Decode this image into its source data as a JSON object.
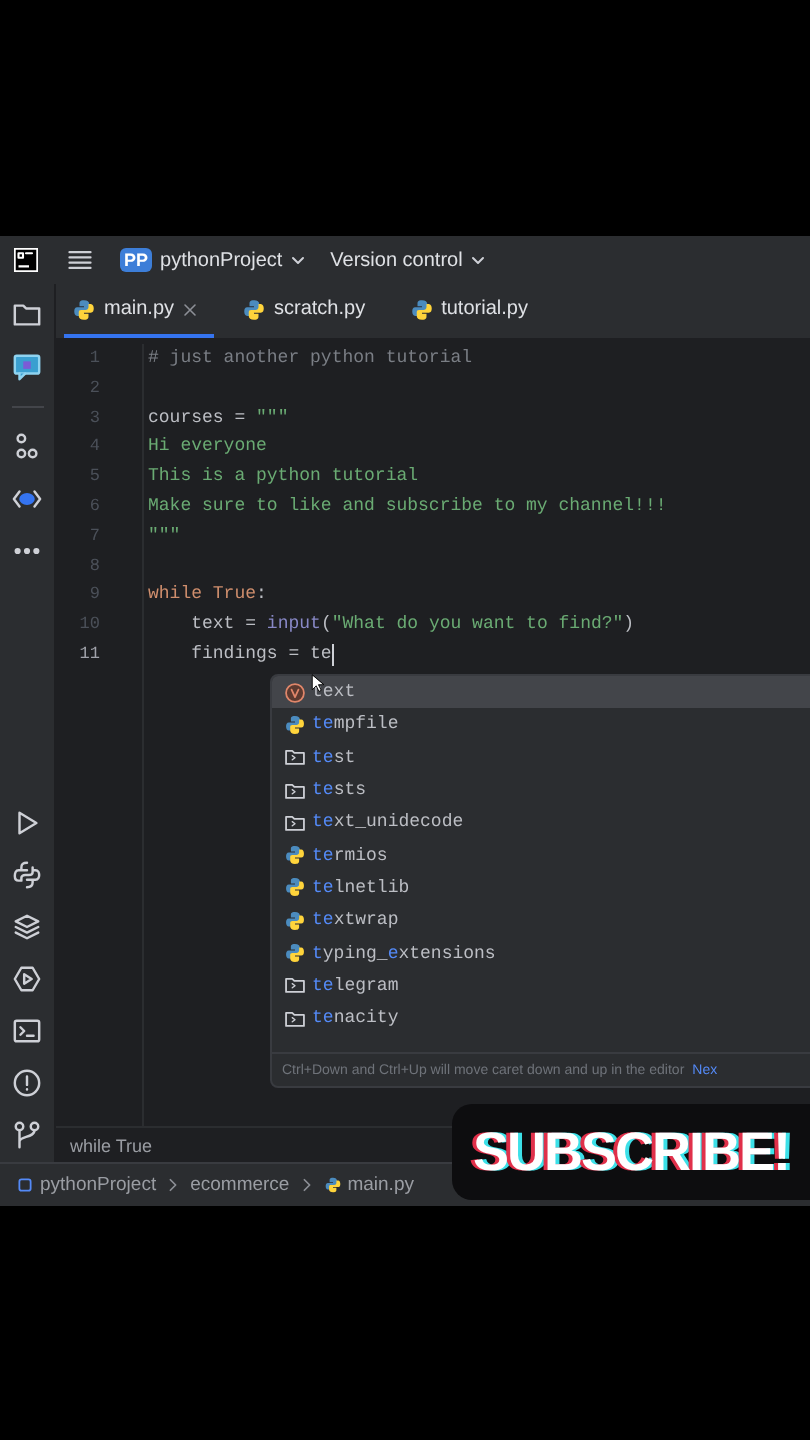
{
  "header": {
    "project_badge": "PP",
    "project": "pythonProject",
    "vcs": "Version control"
  },
  "tabs": [
    {
      "label": "main.py",
      "selected": true,
      "closable": true
    },
    {
      "label": "scratch.py",
      "selected": false,
      "closable": false
    },
    {
      "label": "tutorial.py",
      "selected": false,
      "closable": false
    }
  ],
  "editor": {
    "lines": [
      {
        "number": "1",
        "current": false,
        "segments": [
          {
            "kind": "comment",
            "text": "# just another python tutorial"
          }
        ]
      },
      {
        "number": "2",
        "current": false
      },
      {
        "number": "3",
        "current": false,
        "segments": [
          {
            "kind": "plain",
            "text": "courses = "
          },
          {
            "kind": "string",
            "text": "\"\"\""
          }
        ]
      },
      {
        "number": "4",
        "current": false,
        "segments": [
          {
            "kind": "string",
            "text": "Hi everyone"
          }
        ]
      },
      {
        "number": "5",
        "current": false,
        "segments": [
          {
            "kind": "string",
            "text": "This is a python tutorial"
          }
        ]
      },
      {
        "number": "6",
        "current": false,
        "segments": [
          {
            "kind": "string",
            "text": "Make sure to like and subscribe to my channel!!!"
          }
        ]
      },
      {
        "number": "7",
        "current": false,
        "segments": [
          {
            "kind": "string",
            "text": "\"\"\""
          }
        ]
      },
      {
        "number": "8",
        "current": false
      },
      {
        "number": "9",
        "current": false,
        "segments": [
          {
            "kind": "keyword",
            "text": "while True"
          },
          {
            "kind": "plain",
            "text": ":"
          }
        ]
      },
      {
        "number": "10",
        "current": false,
        "segments": [
          {
            "kind": "plain",
            "text": "    text = "
          },
          {
            "kind": "builtin",
            "text": "input"
          },
          {
            "kind": "plain",
            "text": "("
          },
          {
            "kind": "string",
            "text": "\"What do you want to find?\""
          },
          {
            "kind": "plain",
            "text": ")"
          }
        ]
      },
      {
        "number": "11",
        "current": true,
        "segments": [
          {
            "kind": "plain",
            "text": "    findings = te"
          }
        ]
      }
    ],
    "context": "while True"
  },
  "completion": {
    "items": [
      {
        "kind": "variable",
        "selected": true,
        "segments": [
          {
            "text": "text",
            "matched": false
          }
        ]
      },
      {
        "kind": "module",
        "selected": false,
        "segments": [
          {
            "text": "te",
            "matched": true
          },
          {
            "text": "mpfile",
            "matched": false
          }
        ]
      },
      {
        "kind": "folder",
        "selected": false,
        "segments": [
          {
            "text": "te",
            "matched": true
          },
          {
            "text": "st",
            "matched": false
          }
        ]
      },
      {
        "kind": "folder",
        "selected": false,
        "segments": [
          {
            "text": "te",
            "matched": true
          },
          {
            "text": "sts",
            "matched": false
          }
        ]
      },
      {
        "kind": "folder",
        "selected": false,
        "segments": [
          {
            "text": "te",
            "matched": true
          },
          {
            "text": "xt_unidecode",
            "matched": false
          }
        ]
      },
      {
        "kind": "module",
        "selected": false,
        "segments": [
          {
            "text": "te",
            "matched": true
          },
          {
            "text": "rmios",
            "matched": false
          }
        ]
      },
      {
        "kind": "module",
        "selected": false,
        "segments": [
          {
            "text": "te",
            "matched": true
          },
          {
            "text": "lnetlib",
            "matched": false
          }
        ]
      },
      {
        "kind": "module",
        "selected": false,
        "segments": [
          {
            "text": "te",
            "matched": true
          },
          {
            "text": "xtwrap",
            "matched": false
          }
        ]
      },
      {
        "kind": "module",
        "selected": false,
        "segments": [
          {
            "text": "t",
            "matched": true
          },
          {
            "text": "yping_",
            "matched": false
          },
          {
            "text": "e",
            "matched": true
          },
          {
            "text": "xtensions",
            "matched": false
          }
        ]
      },
      {
        "kind": "folder",
        "selected": false,
        "segments": [
          {
            "text": "te",
            "matched": true
          },
          {
            "text": "legram",
            "matched": false
          }
        ]
      },
      {
        "kind": "folder",
        "selected": false,
        "segments": [
          {
            "text": "te",
            "matched": true
          },
          {
            "text": "nacity",
            "matched": false
          }
        ]
      }
    ],
    "hint": "Ctrl+Down and Ctrl+Up will move caret down and up in the editor",
    "hint_link": "Nex"
  },
  "status_bar": {
    "path": [
      {
        "kind": "project",
        "label": "pythonProject"
      },
      {
        "kind": "folder",
        "label": "ecommerce"
      },
      {
        "kind": "file",
        "label": "main.py"
      }
    ]
  },
  "overlay": {
    "text": "SUBSCRIBE!"
  }
}
